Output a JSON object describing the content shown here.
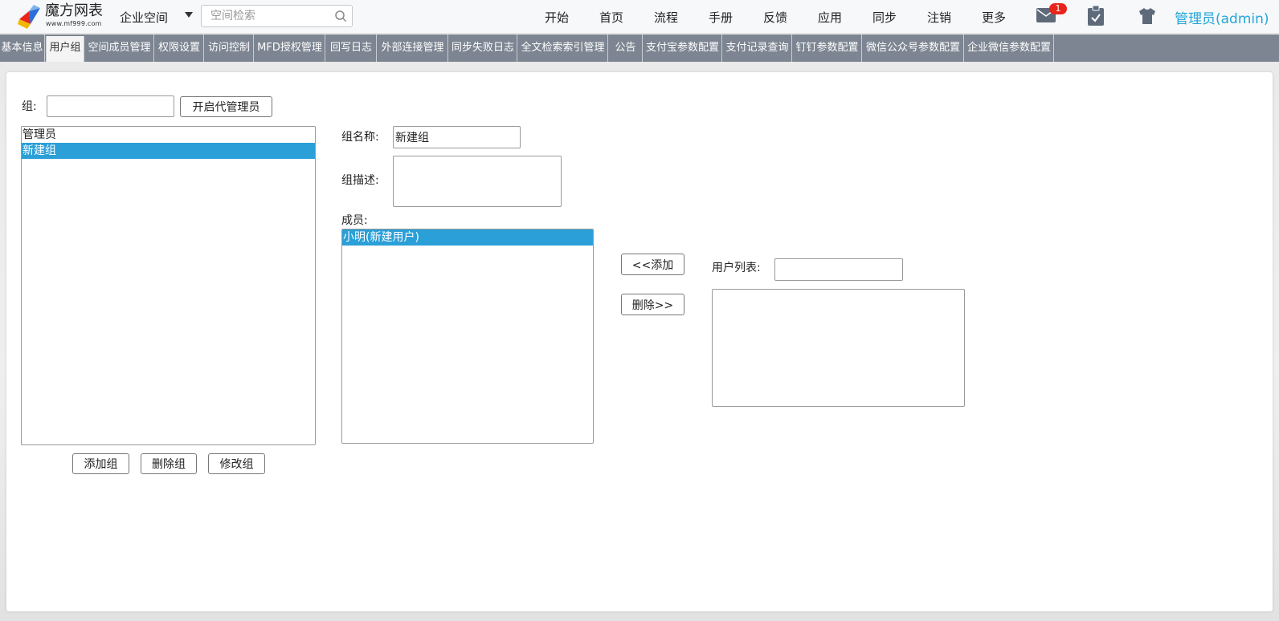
{
  "header": {
    "brand_name": "魔方网表",
    "brand_url": "www.mf999.com",
    "space_label": "企业空间",
    "search_placeholder": "空间检索",
    "nav": [
      "开始",
      "首页",
      "流程",
      "手册",
      "反馈",
      "应用",
      "同步",
      "注销",
      "更多"
    ],
    "mail_badge": "1",
    "user": "管理员(admin)"
  },
  "tabs": [
    {
      "label": "基本信息",
      "active": false
    },
    {
      "label": "用户组",
      "active": true
    },
    {
      "label": "空间成员管理",
      "active": false
    },
    {
      "label": "权限设置",
      "active": false
    },
    {
      "label": "访问控制",
      "active": false
    },
    {
      "label": "MFD授权管理",
      "active": false
    },
    {
      "label": "回写日志",
      "active": false
    },
    {
      "label": "外部连接管理",
      "active": false
    },
    {
      "label": "同步失败日志",
      "active": false
    },
    {
      "label": "全文检索索引管理",
      "active": false
    },
    {
      "label": "公告",
      "active": false
    },
    {
      "label": "支付宝参数配置",
      "active": false
    },
    {
      "label": "支付记录查询",
      "active": false
    },
    {
      "label": "钉钉参数配置",
      "active": false
    },
    {
      "label": "微信公众号参数配置",
      "active": false
    },
    {
      "label": "企业微信参数配置",
      "active": false
    }
  ],
  "group_panel": {
    "filter_label": "组:",
    "filter_value": "",
    "enable_deputy_admin_button": "开启代管理员",
    "groups": [
      {
        "label": "管理员",
        "selected": false
      },
      {
        "label": "新建组",
        "selected": true
      }
    ],
    "add_group_button": "添加组",
    "delete_group_button": "删除组",
    "edit_group_button": "修改组"
  },
  "detail": {
    "name_label": "组名称:",
    "name_value": "新建组",
    "desc_label": "组描述:",
    "desc_value": "",
    "members_label": "成员:",
    "members": [
      {
        "label": "小明(新建用户)",
        "selected": true
      }
    ]
  },
  "transfer": {
    "add_button": "<<添加",
    "remove_button": "删除>>",
    "user_list_label": "用户列表:",
    "user_filter_value": ""
  },
  "colors": {
    "tabbar": "#7c8591",
    "selection": "#2a9fd8",
    "admin_link": "#22a6d8",
    "badge": "#e8241b"
  }
}
